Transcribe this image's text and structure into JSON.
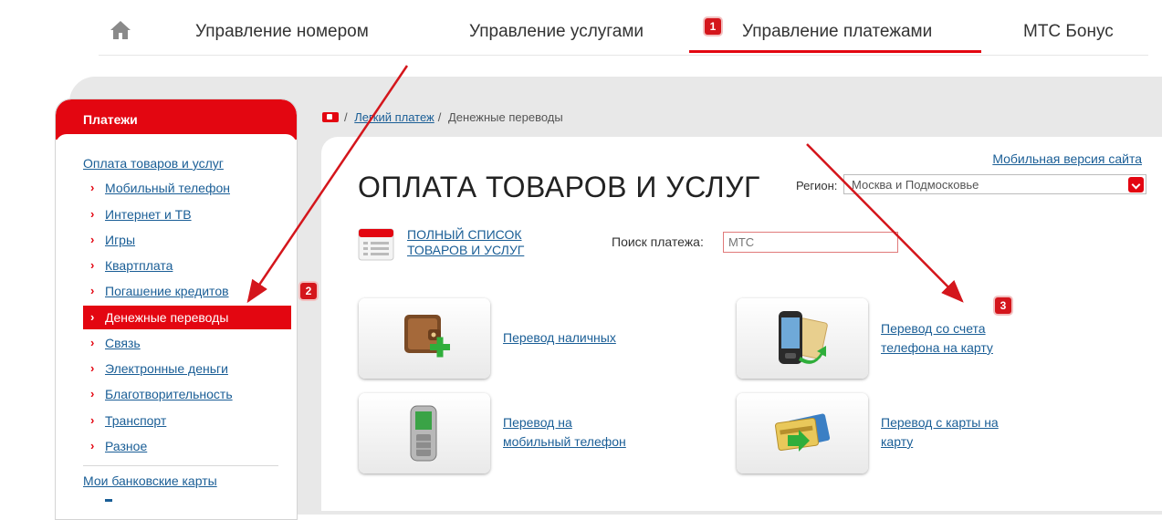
{
  "nav": {
    "items": [
      "Управление номером",
      "Управление услугами",
      "Управление платежами",
      "МТС Бонус"
    ],
    "active_badge": "1"
  },
  "sidebar": {
    "header": "Платежи",
    "category": "Оплата товаров и услуг",
    "items": [
      {
        "label": "Мобильный телефон"
      },
      {
        "label": "Интернет и ТВ"
      },
      {
        "label": "Игры"
      },
      {
        "label": "Квартплата"
      },
      {
        "label": "Погашение кредитов"
      },
      {
        "label": "Денежные переводы",
        "active": true
      },
      {
        "label": "Связь"
      },
      {
        "label": "Электронные деньги"
      },
      {
        "label": "Благотворительность"
      },
      {
        "label": "Транспорт"
      },
      {
        "label": "Разное"
      }
    ],
    "category2": "Мои банковские карты",
    "badge": "2"
  },
  "breadcrumb": {
    "link": "Легкий платеж",
    "separator": "/",
    "current": "Денежные переводы"
  },
  "main": {
    "mobile_link": "Мобильная версия сайта",
    "title": "ОПЛАТА ТОВАРОВ И УСЛУГ",
    "region_label": "Регион:",
    "region_value": "Москва и Подмосковье",
    "full_list_line1": "ПОЛНЫЙ СПИСОК",
    "full_list_line2": "ТОВАРОВ И УСЛУГ",
    "search_label": "Поиск платежа:",
    "search_placeholder": "МТС",
    "badge": "3",
    "tiles": [
      {
        "line1": "Перевод наличных",
        "line2": "",
        "icon": "wallet-plus-icon"
      },
      {
        "line1": "Перевод со счета",
        "line2": "телефона на карту",
        "icon": "phone-to-card-icon"
      },
      {
        "line1": "Перевод на",
        "line2": "мобильный телефон",
        "icon": "phone-icon"
      },
      {
        "line1": "Перевод с карты на",
        "line2": "карту",
        "icon": "card-to-card-icon"
      }
    ]
  },
  "colors": {
    "accent": "#e30611",
    "link": "#1a5e96"
  }
}
